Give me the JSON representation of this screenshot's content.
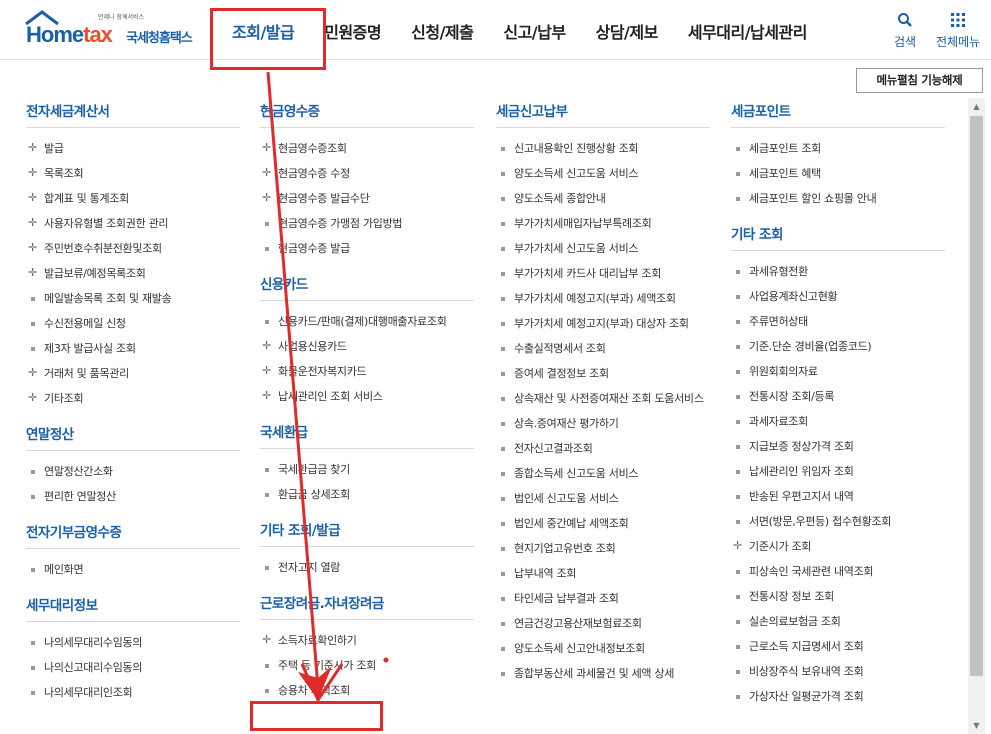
{
  "header": {
    "logo_tag": "언제나 함께서비스",
    "logo_brand_a": "Home",
    "logo_brand_b": "tax",
    "logo_kr": "국세청홈택스",
    "nav": [
      "조회/발급",
      "민원증명",
      "신청/제출",
      "신고/납부",
      "상담/제보",
      "세무대리/납세관리"
    ],
    "search_label": "검색",
    "allmenu_label": "전체메뉴"
  },
  "fold_button": "메뉴펼침 기능해제",
  "columns": [
    [
      {
        "title": "전자세금계산서",
        "items": [
          {
            "label": "발급",
            "mark": "plus"
          },
          {
            "label": "목록조회",
            "mark": "plus"
          },
          {
            "label": "합계표 및 통계조회",
            "mark": "plus"
          },
          {
            "label": "사용자유형별 조회권한 관리",
            "mark": "plus"
          },
          {
            "label": "주민번호수취분전환및조회",
            "mark": "plus"
          },
          {
            "label": "발급보류/예정목록조회",
            "mark": "plus"
          },
          {
            "label": "메일발송목록 조회 및 재발송",
            "mark": "dot"
          },
          {
            "label": "수신전용메일 신청",
            "mark": "dot"
          },
          {
            "label": "제3자 발급사실 조회",
            "mark": "dot"
          },
          {
            "label": "거래처 및 품목관리",
            "mark": "plus"
          },
          {
            "label": "기타조회",
            "mark": "plus"
          }
        ]
      },
      {
        "title": "연말정산",
        "items": [
          {
            "label": "연말정산간소화",
            "mark": "dot"
          },
          {
            "label": "편리한 연말정산",
            "mark": "dot"
          }
        ]
      },
      {
        "title": "전자기부금영수증",
        "items": [
          {
            "label": "메인화면",
            "mark": "dot"
          }
        ]
      },
      {
        "title": "세무대리정보",
        "items": [
          {
            "label": "나의세무대리수임동의",
            "mark": "dot"
          },
          {
            "label": "나의신고대리수임동의",
            "mark": "dot"
          },
          {
            "label": "나의세무대리인조회",
            "mark": "dot"
          }
        ]
      }
    ],
    [
      {
        "title": "현금영수증",
        "items": [
          {
            "label": "현금영수증조회",
            "mark": "plus"
          },
          {
            "label": "현금영수증 수정",
            "mark": "plus"
          },
          {
            "label": "현금영수증 발급수단",
            "mark": "plus"
          },
          {
            "label": "현금영수증 가맹점 가입방법",
            "mark": "dot"
          },
          {
            "label": "현금영수증 발급",
            "mark": "dot"
          }
        ]
      },
      {
        "title": "신용카드",
        "items": [
          {
            "label": "신용카드/판매(결제)대행매출자료조회",
            "mark": "dot"
          },
          {
            "label": "사업용신용카드",
            "mark": "plus"
          },
          {
            "label": "화물운전자복지카드",
            "mark": "plus"
          },
          {
            "label": "납세관리인 조회 서비스",
            "mark": "plus"
          }
        ]
      },
      {
        "title": "국세환급",
        "items": [
          {
            "label": "국세환급금 찾기",
            "mark": "dot"
          },
          {
            "label": "환급금 상세조회",
            "mark": "dot"
          }
        ]
      },
      {
        "title": "기타 조회/발급",
        "items": [
          {
            "label": "전자고지 열람",
            "mark": "dot"
          }
        ]
      },
      {
        "title": "근로장려금.자녀장려금",
        "items": [
          {
            "label": "소득자료확인하기",
            "mark": "plus"
          },
          {
            "label": "주택 등 기준시가 조회",
            "mark": "dot"
          },
          {
            "label": "승용차 가액조회",
            "mark": "dot"
          }
        ]
      }
    ],
    [
      {
        "title": "세금신고납부",
        "items": [
          {
            "label": "신고내용확인 진행상황 조회",
            "mark": "dot"
          },
          {
            "label": "양도소득세 신고도움 서비스",
            "mark": "dot"
          },
          {
            "label": "양도소득세 종합안내",
            "mark": "dot"
          },
          {
            "label": "부가가치세매입자납부특례조회",
            "mark": "dot"
          },
          {
            "label": "부가가치세 신고도움 서비스",
            "mark": "dot"
          },
          {
            "label": "부가가치세 카드사 대리납부 조회",
            "mark": "dot"
          },
          {
            "label": "부가가치세 예정고지(부과) 세액조회",
            "mark": "dot"
          },
          {
            "label": "부가가치세 예정고지(부과) 대상자 조회",
            "mark": "dot"
          },
          {
            "label": "수출실적명세서 조회",
            "mark": "dot"
          },
          {
            "label": "증여세 결정정보 조회",
            "mark": "dot"
          },
          {
            "label": "상속재산 및 사전증여재산 조회 도움서비스",
            "mark": "dot"
          },
          {
            "label": "상속.증여재산 평가하기",
            "mark": "dot"
          },
          {
            "label": "전자신고결과조회",
            "mark": "dot"
          },
          {
            "label": "종합소득세 신고도움 서비스",
            "mark": "dot"
          },
          {
            "label": "법인세 신고도움 서비스",
            "mark": "dot"
          },
          {
            "label": "법인세 중간예납 세액조회",
            "mark": "dot"
          },
          {
            "label": "현지기업고유번호 조회",
            "mark": "dot"
          },
          {
            "label": "납부내역 조회",
            "mark": "dot"
          },
          {
            "label": "타인세금 납부결과 조회",
            "mark": "dot"
          },
          {
            "label": "연금건강고용산재보험료조회",
            "mark": "dot"
          },
          {
            "label": "양도소득세 신고안내정보조회",
            "mark": "dot"
          },
          {
            "label": "종합부동산세 과세물건 및 세액 상세",
            "mark": "dot"
          }
        ]
      }
    ],
    [
      {
        "title": "세금포인트",
        "items": [
          {
            "label": "세금포인트 조회",
            "mark": "dot"
          },
          {
            "label": "세금포인트 혜택",
            "mark": "dot"
          },
          {
            "label": "세금포인트 할인 쇼핑몰 안내",
            "mark": "dot"
          }
        ]
      },
      {
        "title": "기타 조회",
        "items": [
          {
            "label": "과세유형전환",
            "mark": "dot"
          },
          {
            "label": "사업용계좌신고현황",
            "mark": "dot"
          },
          {
            "label": "주류면허상태",
            "mark": "dot"
          },
          {
            "label": "기준.단순 경비율(업종코드)",
            "mark": "dot"
          },
          {
            "label": "위원회회의자료",
            "mark": "dot"
          },
          {
            "label": "전통시장 조회/등록",
            "mark": "dot"
          },
          {
            "label": "과세자료조회",
            "mark": "dot"
          },
          {
            "label": "지급보증 정상가격 조회",
            "mark": "dot"
          },
          {
            "label": "납세관리인 위임자 조회",
            "mark": "dot"
          },
          {
            "label": "반송된 우편고지서 내역",
            "mark": "dot"
          },
          {
            "label": "서면(방문,우편등) 접수현황조회",
            "mark": "dot"
          },
          {
            "label": "기준시가 조회",
            "mark": "plus"
          },
          {
            "label": "피상속인 국세관련 내역조회",
            "mark": "dot"
          },
          {
            "label": "전통시장 정보 조회",
            "mark": "dot"
          },
          {
            "label": "실손의료보험금 조회",
            "mark": "dot"
          },
          {
            "label": "근로소득 지급명세서 조회",
            "mark": "dot"
          },
          {
            "label": "비상장주식 보유내역 조회",
            "mark": "dot"
          },
          {
            "label": "가상자산 일평균가격 조회",
            "mark": "dot"
          }
        ]
      }
    ]
  ],
  "colors": {
    "brand": "#1a5fa8",
    "annotation": "#e02b2b"
  }
}
